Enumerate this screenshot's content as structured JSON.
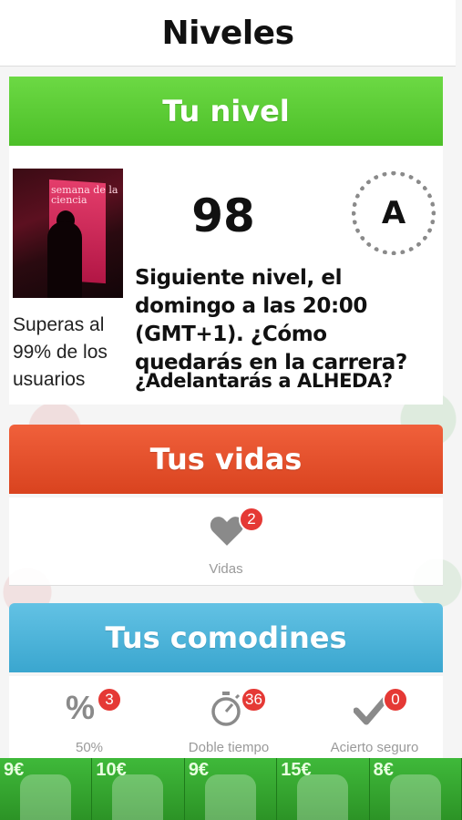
{
  "header": {
    "title": "Niveles"
  },
  "level": {
    "banner": "Tu nivel",
    "number": "98",
    "rank": "A",
    "percentile_text": "Superas al 99% de los usuarios",
    "next_level_text": "Siguiente nivel, el domingo a las 20:00 (GMT+1). ¿Cómo quedarás en la carrera?",
    "overtake_text": "¿Adelantarás a ALHEDA?",
    "photo_caption": "semana de la ciencia"
  },
  "lives": {
    "banner": "Tus vidas",
    "count": "2",
    "label": "Vidas",
    "icon": "heart-icon"
  },
  "jokers": {
    "banner": "Tus comodines",
    "items": [
      {
        "icon": "percent-icon",
        "count": "3",
        "label": "50%"
      },
      {
        "icon": "stopwatch-icon",
        "count": "36",
        "label": "Doble tiempo"
      },
      {
        "icon": "checkmark-icon",
        "count": "0",
        "label": "Acierto seguro"
      }
    ]
  },
  "ads": [
    "9€",
    "10€",
    "9€",
    "15€",
    "8€"
  ],
  "colors": {
    "green": "#4cbf28",
    "red": "#d9431f",
    "blue": "#3aa6cf",
    "badge": "#e53935"
  }
}
